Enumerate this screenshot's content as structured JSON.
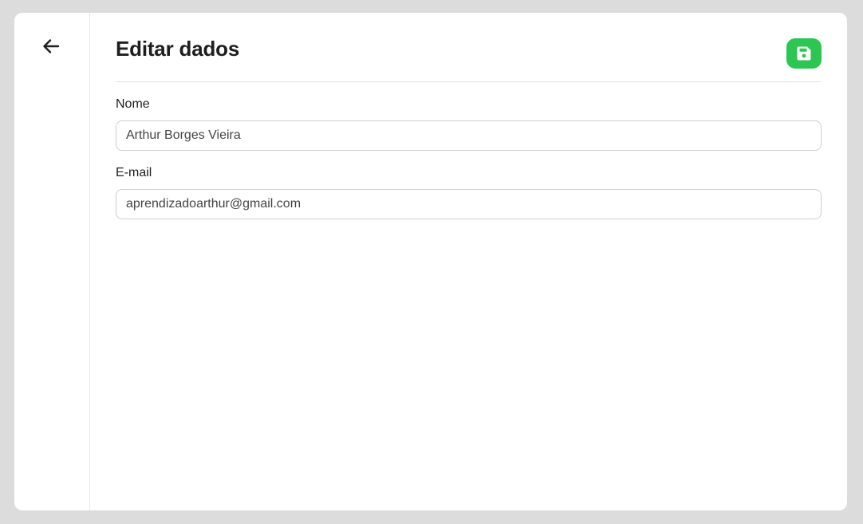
{
  "header": {
    "title": "Editar dados"
  },
  "icons": {
    "back": "arrow-left-icon",
    "save": "floppy-disk-icon"
  },
  "colors": {
    "accent": "#2dc653",
    "background": "#dcdcdc",
    "card": "#ffffff"
  },
  "form": {
    "name_label": "Nome",
    "name_value": "Arthur Borges Vieira",
    "email_label": "E-mail",
    "email_value": "aprendizadoarthur@gmail.com"
  }
}
